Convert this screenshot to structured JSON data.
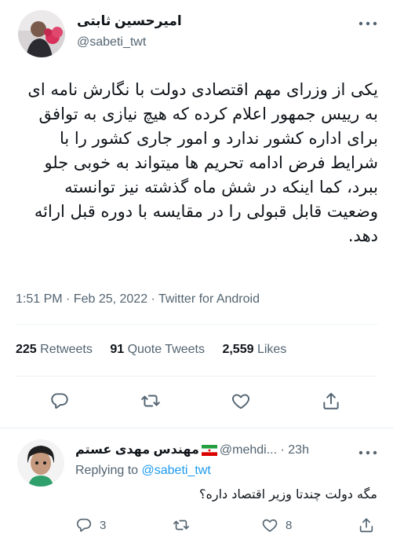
{
  "tweet": {
    "author_name": "امیرحسین ثابتی",
    "author_handle": "@sabeti_twt",
    "text": "یکی از وزرای مهم اقتصادی دولت با نگارش نامه ای به رییس جمهور اعلام کرده که هیچ نیازی به توافق برای اداره کشور ندارد و امور جاری کشور را با شرایط فرض ادامه تحریم ها میتواند به خوبی جلو ببرد، کما اینکه در شش ماه گذشته نیز توانسته وضعیت قابل قبولی را در مقایسه با دوره قبل ارائه دهد.",
    "meta": "1:51 PM · Feb 25, 2022 · Twitter for Android",
    "stats": {
      "retweets_count": "225",
      "retweets_label": "Retweets",
      "quotes_count": "91",
      "quotes_label": "Quote Tweets",
      "likes_count": "2,559",
      "likes_label": "Likes"
    }
  },
  "reply": {
    "author_name": "مهندس مهدی عستم",
    "author_handle": "@mehdi...",
    "dot": "·",
    "time": "23h",
    "replying_prefix": "Replying to",
    "replying_to": "@sabeti_twt",
    "text": "مگه دولت چندتا وزیر اقتصاد داره؟",
    "reply_count": "3",
    "like_count": "8"
  },
  "icons": {
    "more": "more-horizontal-icon",
    "reply": "reply-icon",
    "retweet": "retweet-icon",
    "like": "heart-icon",
    "share": "share-icon",
    "flag": "iran-flag-icon"
  },
  "colors": {
    "text": "#0f1419",
    "secondary": "#536471",
    "link": "#1d9bf0",
    "divider": "#eff3f4"
  }
}
